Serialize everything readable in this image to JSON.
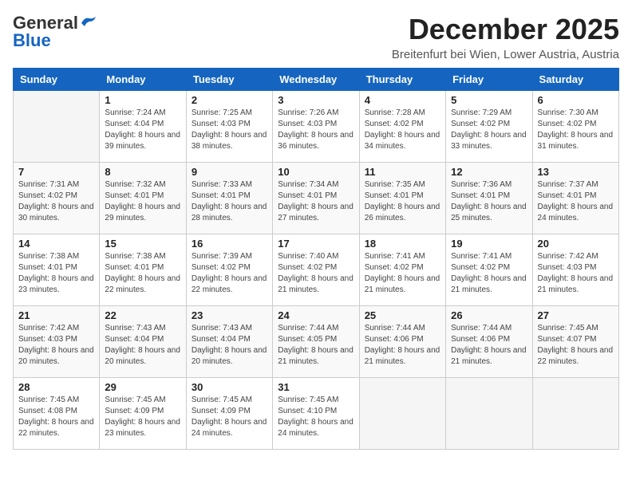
{
  "logo": {
    "general": "General",
    "blue": "Blue"
  },
  "header": {
    "month": "December 2025",
    "location": "Breitenfurt bei Wien, Lower Austria, Austria"
  },
  "days_of_week": [
    "Sunday",
    "Monday",
    "Tuesday",
    "Wednesday",
    "Thursday",
    "Friday",
    "Saturday"
  ],
  "weeks": [
    [
      {
        "day": "",
        "sunrise": "",
        "sunset": "",
        "daylight": ""
      },
      {
        "day": "1",
        "sunrise": "Sunrise: 7:24 AM",
        "sunset": "Sunset: 4:04 PM",
        "daylight": "Daylight: 8 hours and 39 minutes."
      },
      {
        "day": "2",
        "sunrise": "Sunrise: 7:25 AM",
        "sunset": "Sunset: 4:03 PM",
        "daylight": "Daylight: 8 hours and 38 minutes."
      },
      {
        "day": "3",
        "sunrise": "Sunrise: 7:26 AM",
        "sunset": "Sunset: 4:03 PM",
        "daylight": "Daylight: 8 hours and 36 minutes."
      },
      {
        "day": "4",
        "sunrise": "Sunrise: 7:28 AM",
        "sunset": "Sunset: 4:02 PM",
        "daylight": "Daylight: 8 hours and 34 minutes."
      },
      {
        "day": "5",
        "sunrise": "Sunrise: 7:29 AM",
        "sunset": "Sunset: 4:02 PM",
        "daylight": "Daylight: 8 hours and 33 minutes."
      },
      {
        "day": "6",
        "sunrise": "Sunrise: 7:30 AM",
        "sunset": "Sunset: 4:02 PM",
        "daylight": "Daylight: 8 hours and 31 minutes."
      }
    ],
    [
      {
        "day": "7",
        "sunrise": "Sunrise: 7:31 AM",
        "sunset": "Sunset: 4:02 PM",
        "daylight": "Daylight: 8 hours and 30 minutes."
      },
      {
        "day": "8",
        "sunrise": "Sunrise: 7:32 AM",
        "sunset": "Sunset: 4:01 PM",
        "daylight": "Daylight: 8 hours and 29 minutes."
      },
      {
        "day": "9",
        "sunrise": "Sunrise: 7:33 AM",
        "sunset": "Sunset: 4:01 PM",
        "daylight": "Daylight: 8 hours and 28 minutes."
      },
      {
        "day": "10",
        "sunrise": "Sunrise: 7:34 AM",
        "sunset": "Sunset: 4:01 PM",
        "daylight": "Daylight: 8 hours and 27 minutes."
      },
      {
        "day": "11",
        "sunrise": "Sunrise: 7:35 AM",
        "sunset": "Sunset: 4:01 PM",
        "daylight": "Daylight: 8 hours and 26 minutes."
      },
      {
        "day": "12",
        "sunrise": "Sunrise: 7:36 AM",
        "sunset": "Sunset: 4:01 PM",
        "daylight": "Daylight: 8 hours and 25 minutes."
      },
      {
        "day": "13",
        "sunrise": "Sunrise: 7:37 AM",
        "sunset": "Sunset: 4:01 PM",
        "daylight": "Daylight: 8 hours and 24 minutes."
      }
    ],
    [
      {
        "day": "14",
        "sunrise": "Sunrise: 7:38 AM",
        "sunset": "Sunset: 4:01 PM",
        "daylight": "Daylight: 8 hours and 23 minutes."
      },
      {
        "day": "15",
        "sunrise": "Sunrise: 7:38 AM",
        "sunset": "Sunset: 4:01 PM",
        "daylight": "Daylight: 8 hours and 22 minutes."
      },
      {
        "day": "16",
        "sunrise": "Sunrise: 7:39 AM",
        "sunset": "Sunset: 4:02 PM",
        "daylight": "Daylight: 8 hours and 22 minutes."
      },
      {
        "day": "17",
        "sunrise": "Sunrise: 7:40 AM",
        "sunset": "Sunset: 4:02 PM",
        "daylight": "Daylight: 8 hours and 21 minutes."
      },
      {
        "day": "18",
        "sunrise": "Sunrise: 7:41 AM",
        "sunset": "Sunset: 4:02 PM",
        "daylight": "Daylight: 8 hours and 21 minutes."
      },
      {
        "day": "19",
        "sunrise": "Sunrise: 7:41 AM",
        "sunset": "Sunset: 4:02 PM",
        "daylight": "Daylight: 8 hours and 21 minutes."
      },
      {
        "day": "20",
        "sunrise": "Sunrise: 7:42 AM",
        "sunset": "Sunset: 4:03 PM",
        "daylight": "Daylight: 8 hours and 21 minutes."
      }
    ],
    [
      {
        "day": "21",
        "sunrise": "Sunrise: 7:42 AM",
        "sunset": "Sunset: 4:03 PM",
        "daylight": "Daylight: 8 hours and 20 minutes."
      },
      {
        "day": "22",
        "sunrise": "Sunrise: 7:43 AM",
        "sunset": "Sunset: 4:04 PM",
        "daylight": "Daylight: 8 hours and 20 minutes."
      },
      {
        "day": "23",
        "sunrise": "Sunrise: 7:43 AM",
        "sunset": "Sunset: 4:04 PM",
        "daylight": "Daylight: 8 hours and 20 minutes."
      },
      {
        "day": "24",
        "sunrise": "Sunrise: 7:44 AM",
        "sunset": "Sunset: 4:05 PM",
        "daylight": "Daylight: 8 hours and 21 minutes."
      },
      {
        "day": "25",
        "sunrise": "Sunrise: 7:44 AM",
        "sunset": "Sunset: 4:06 PM",
        "daylight": "Daylight: 8 hours and 21 minutes."
      },
      {
        "day": "26",
        "sunrise": "Sunrise: 7:44 AM",
        "sunset": "Sunset: 4:06 PM",
        "daylight": "Daylight: 8 hours and 21 minutes."
      },
      {
        "day": "27",
        "sunrise": "Sunrise: 7:45 AM",
        "sunset": "Sunset: 4:07 PM",
        "daylight": "Daylight: 8 hours and 22 minutes."
      }
    ],
    [
      {
        "day": "28",
        "sunrise": "Sunrise: 7:45 AM",
        "sunset": "Sunset: 4:08 PM",
        "daylight": "Daylight: 8 hours and 22 minutes."
      },
      {
        "day": "29",
        "sunrise": "Sunrise: 7:45 AM",
        "sunset": "Sunset: 4:09 PM",
        "daylight": "Daylight: 8 hours and 23 minutes."
      },
      {
        "day": "30",
        "sunrise": "Sunrise: 7:45 AM",
        "sunset": "Sunset: 4:09 PM",
        "daylight": "Daylight: 8 hours and 24 minutes."
      },
      {
        "day": "31",
        "sunrise": "Sunrise: 7:45 AM",
        "sunset": "Sunset: 4:10 PM",
        "daylight": "Daylight: 8 hours and 24 minutes."
      },
      {
        "day": "",
        "sunrise": "",
        "sunset": "",
        "daylight": ""
      },
      {
        "day": "",
        "sunrise": "",
        "sunset": "",
        "daylight": ""
      },
      {
        "day": "",
        "sunrise": "",
        "sunset": "",
        "daylight": ""
      }
    ]
  ]
}
